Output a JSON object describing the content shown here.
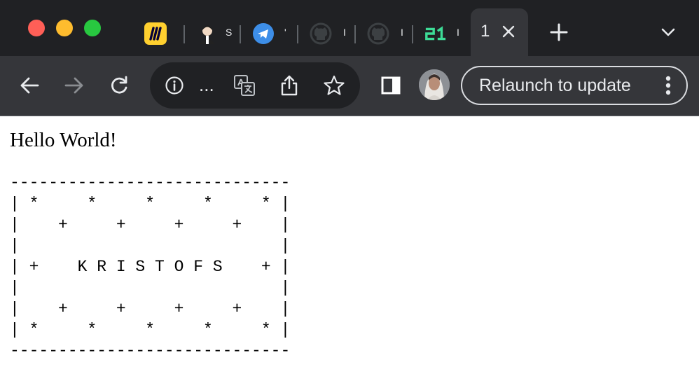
{
  "tabs": [
    {
      "favicon": "miro-icon",
      "title": ""
    },
    {
      "favicon": "person-avatar-icon",
      "title": "S"
    },
    {
      "favicon": "telegram-icon",
      "title": "'"
    },
    {
      "favicon": "github-icon",
      "title": "I"
    },
    {
      "favicon": "github-icon",
      "title": "I"
    },
    {
      "favicon": "21st-icon",
      "title": "I"
    }
  ],
  "active_tab": {
    "title": "1",
    "close_icon": "close-icon"
  },
  "new_tab_icon": "plus-icon",
  "tab_search_icon": "chevron-down-icon",
  "toolbar": {
    "back_icon": "arrow-left-icon",
    "forward_icon": "arrow-right-icon",
    "reload_icon": "reload-icon",
    "site_info_icon": "info-icon",
    "url_text": "...",
    "translate_icon": "translate-icon",
    "share_icon": "share-icon",
    "bookmark_icon": "star-icon",
    "sidepanel_icon": "side-panel-icon",
    "profile_icon": "profile-avatar",
    "relaunch_label": "Relaunch to update",
    "menu_icon": "kebab-menu-icon"
  },
  "page": {
    "heading": "Hello World!",
    "art_lines": [
      "-----------------------------",
      "| *     *     *     *     * |",
      "|    +     +     +     +    |",
      "|                           |",
      "| +    K R I S T O F S    + |",
      "|                           |",
      "|    +     +     +     +    |",
      "| *     *     *     *     * |",
      "-----------------------------"
    ]
  },
  "colors": {
    "tabstrip_bg": "#202124",
    "toolbar_bg": "#35363a",
    "omnibox_bg": "#202124",
    "text_light": "#e8eaed",
    "traffic_close": "#ff5f57",
    "traffic_min": "#febc2e",
    "traffic_max": "#28c840"
  }
}
